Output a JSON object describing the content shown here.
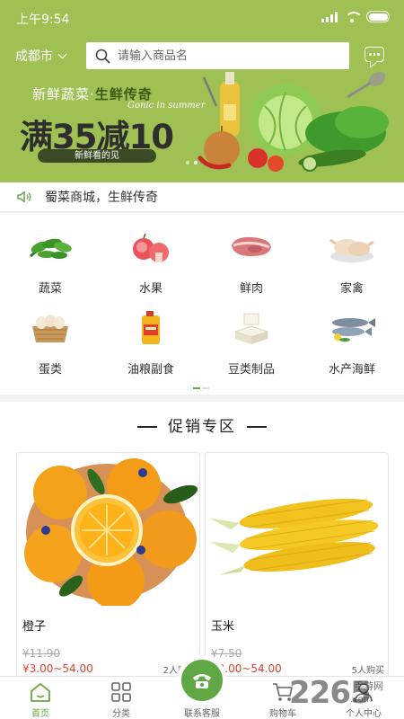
{
  "status_bar": {
    "time": "上午9:54"
  },
  "header": {
    "city": "成都市",
    "search_placeholder": "请输入商品名"
  },
  "banner": {
    "headline_plain": "新鲜蔬菜·",
    "headline_bold": "生鲜传奇",
    "subtitle": "Gonic in summer",
    "promo": "满35减10",
    "pill": "新鲜看的见"
  },
  "notice": {
    "text": "蜀菜商城，生鲜传奇"
  },
  "categories": [
    {
      "label": "蔬菜",
      "icon": "vegetable-icon"
    },
    {
      "label": "水果",
      "icon": "fruit-icon"
    },
    {
      "label": "鲜肉",
      "icon": "meat-icon"
    },
    {
      "label": "家禽",
      "icon": "poultry-icon"
    },
    {
      "label": "蛋类",
      "icon": "egg-icon"
    },
    {
      "label": "油粮副食",
      "icon": "oil-icon"
    },
    {
      "label": "豆类制品",
      "icon": "tofu-icon"
    },
    {
      "label": "水产海鲜",
      "icon": "fish-icon"
    }
  ],
  "promo_section": {
    "title": "促销专区",
    "products": [
      {
        "name": "橙子",
        "old_price": "¥11.90",
        "price": "¥3.00~54.00",
        "sold": "2人购买"
      },
      {
        "name": "玉米",
        "old_price": "¥7.50",
        "price": "¥3.00~54.00",
        "sold": "5人购买"
      }
    ]
  },
  "tab_bar": {
    "items": [
      {
        "label": "首页",
        "icon": "home-icon",
        "active": true
      },
      {
        "label": "分类",
        "icon": "category-grid-icon",
        "active": false
      },
      {
        "label": "联系客服",
        "icon": "phone-icon",
        "active": false
      },
      {
        "label": "购物车",
        "icon": "cart-icon",
        "active": false
      },
      {
        "label": "个人中心",
        "icon": "user-icon",
        "active": false
      }
    ]
  },
  "watermark": {
    "brand": "2265",
    "suffix": "手游网",
    "url": ".com"
  },
  "colors": {
    "theme_green": "#9fc052",
    "accent_green": "#6ba53c",
    "price_red": "#e0412b"
  }
}
